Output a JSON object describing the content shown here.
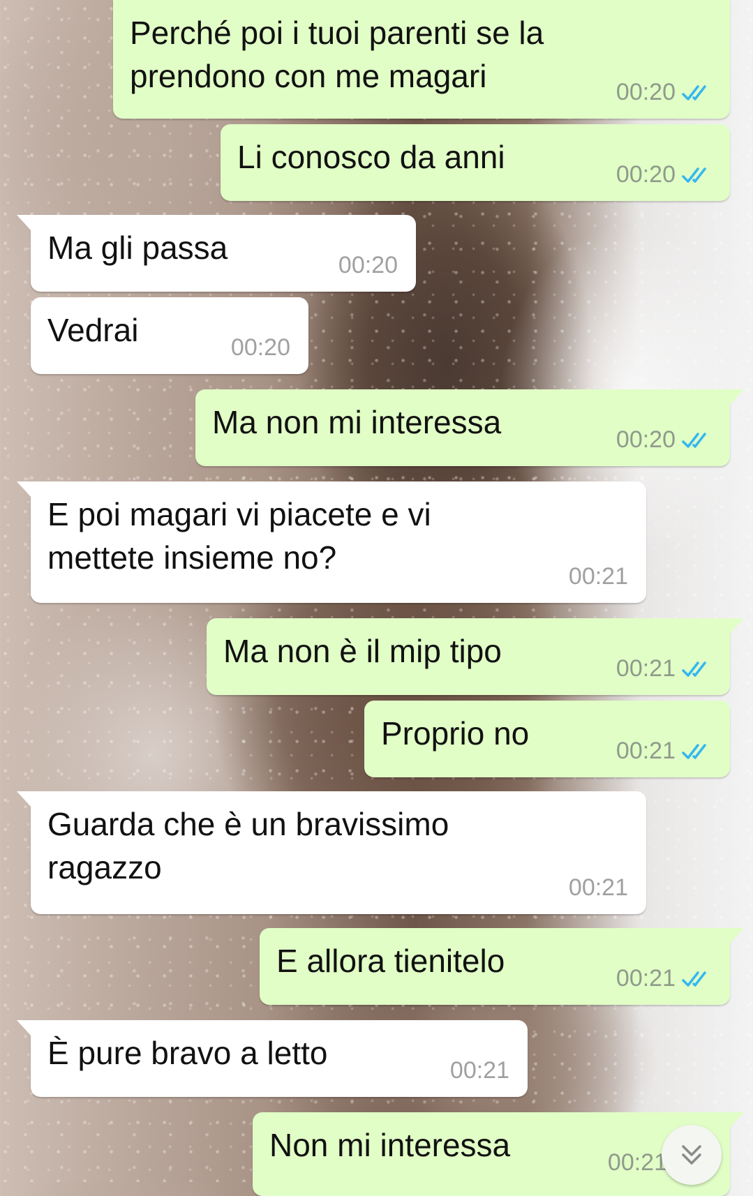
{
  "colors": {
    "outgoing_bubble": "#e1fec6",
    "incoming_bubble": "#ffffff",
    "read_ticks": "#34b7f1"
  },
  "messages": [
    {
      "direction": "out",
      "text": "Perché poi i tuoi parenti se la\nprendono con me magari",
      "time": "00:20",
      "status": "read"
    },
    {
      "direction": "out",
      "text": "Li conosco da anni",
      "time": "00:20",
      "status": "read"
    },
    {
      "direction": "in",
      "text": "Ma gli passa",
      "time": "00:20"
    },
    {
      "direction": "in",
      "text": "Vedrai",
      "time": "00:20"
    },
    {
      "direction": "out",
      "text": "Ma non mi interessa",
      "time": "00:20",
      "status": "read"
    },
    {
      "direction": "in",
      "text": "E poi magari vi piacete e vi\nmettete insieme no?",
      "time": "00:21"
    },
    {
      "direction": "out",
      "text": "Ma non è il mip tipo",
      "time": "00:21",
      "status": "read"
    },
    {
      "direction": "out",
      "text": "Proprio no",
      "time": "00:21",
      "status": "read"
    },
    {
      "direction": "in",
      "text": "Guarda che è un bravissimo\nragazzo",
      "time": "00:21"
    },
    {
      "direction": "out",
      "text": "E allora tienitelo",
      "time": "00:21",
      "status": "read"
    },
    {
      "direction": "in",
      "text": "È pure bravo a letto",
      "time": "00:21"
    },
    {
      "direction": "out",
      "text": "Non mi interessa",
      "time": "00:21",
      "status": "read"
    }
  ],
  "scroll_to_bottom": {
    "icon": "double-chevron-down-icon"
  }
}
